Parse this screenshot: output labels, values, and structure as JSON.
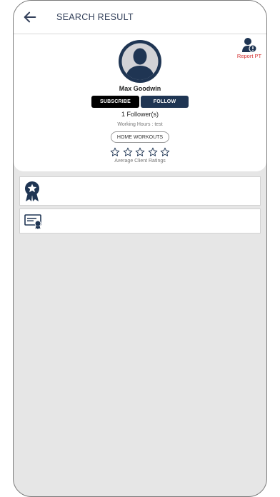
{
  "header": {
    "title": "SEARCH RESULT"
  },
  "profile": {
    "name": "Max Goodwin",
    "subscribe_label": "SUBSCRIBE",
    "follow_label": "FOLLOW",
    "followers_text": "1 Follower(s)",
    "working_hours_text": "Working Hours : test",
    "tag_label": "HOME WORKOUTS",
    "rating": 0,
    "rating_max": 5,
    "ratings_label": "Average Client Ratings",
    "report_label": "Report PT"
  },
  "icons": {
    "back": "arrow-left-icon",
    "avatar": "user-avatar-icon",
    "report": "user-report-icon",
    "star": "star-outline-icon",
    "award": "award-ribbon-icon",
    "certificate": "certificate-icon"
  },
  "colors": {
    "primary_dark": "#1f3553",
    "subscribe_bg": "#000000",
    "report_red": "#d32f2f",
    "background_gray": "#e6e6e6"
  }
}
